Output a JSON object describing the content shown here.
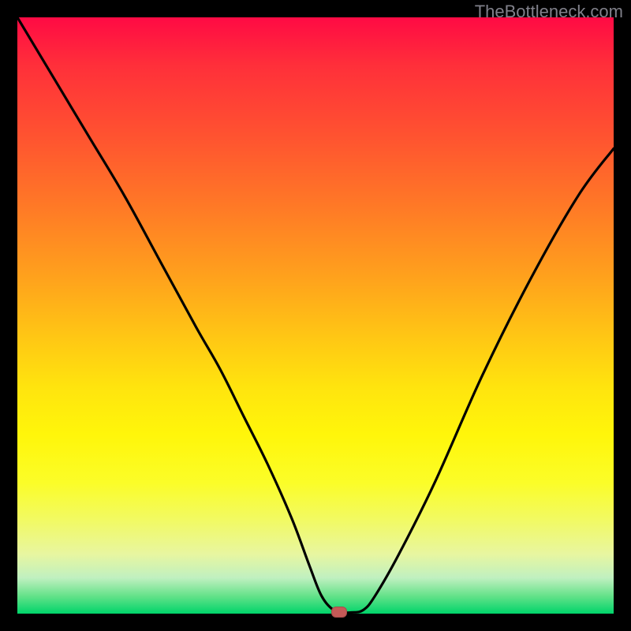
{
  "watermark": "TheBottleneck.com",
  "colors": {
    "frame": "#000000",
    "curve": "#000000",
    "marker": "#c45a57"
  },
  "chart_data": {
    "type": "line",
    "title": "",
    "xlabel": "",
    "ylabel": "",
    "xlim": [
      0,
      100
    ],
    "ylim": [
      0,
      100
    ],
    "grid": false,
    "legend": false,
    "series": [
      {
        "name": "bottleneck-curve",
        "x": [
          0,
          6,
          12,
          18,
          24,
          30,
          34,
          38,
          42,
          46,
          49,
          51,
          53,
          54.5,
          56,
          58,
          60,
          64,
          70,
          78,
          86,
          94,
          100
        ],
        "y": [
          100,
          90,
          80,
          70,
          59,
          48,
          41,
          33,
          25,
          16,
          8,
          3,
          0.6,
          0.2,
          0.2,
          0.6,
          3,
          10,
          22,
          40,
          56,
          70,
          78
        ]
      }
    ],
    "marker": {
      "x": 54,
      "y": 0.2
    }
  }
}
